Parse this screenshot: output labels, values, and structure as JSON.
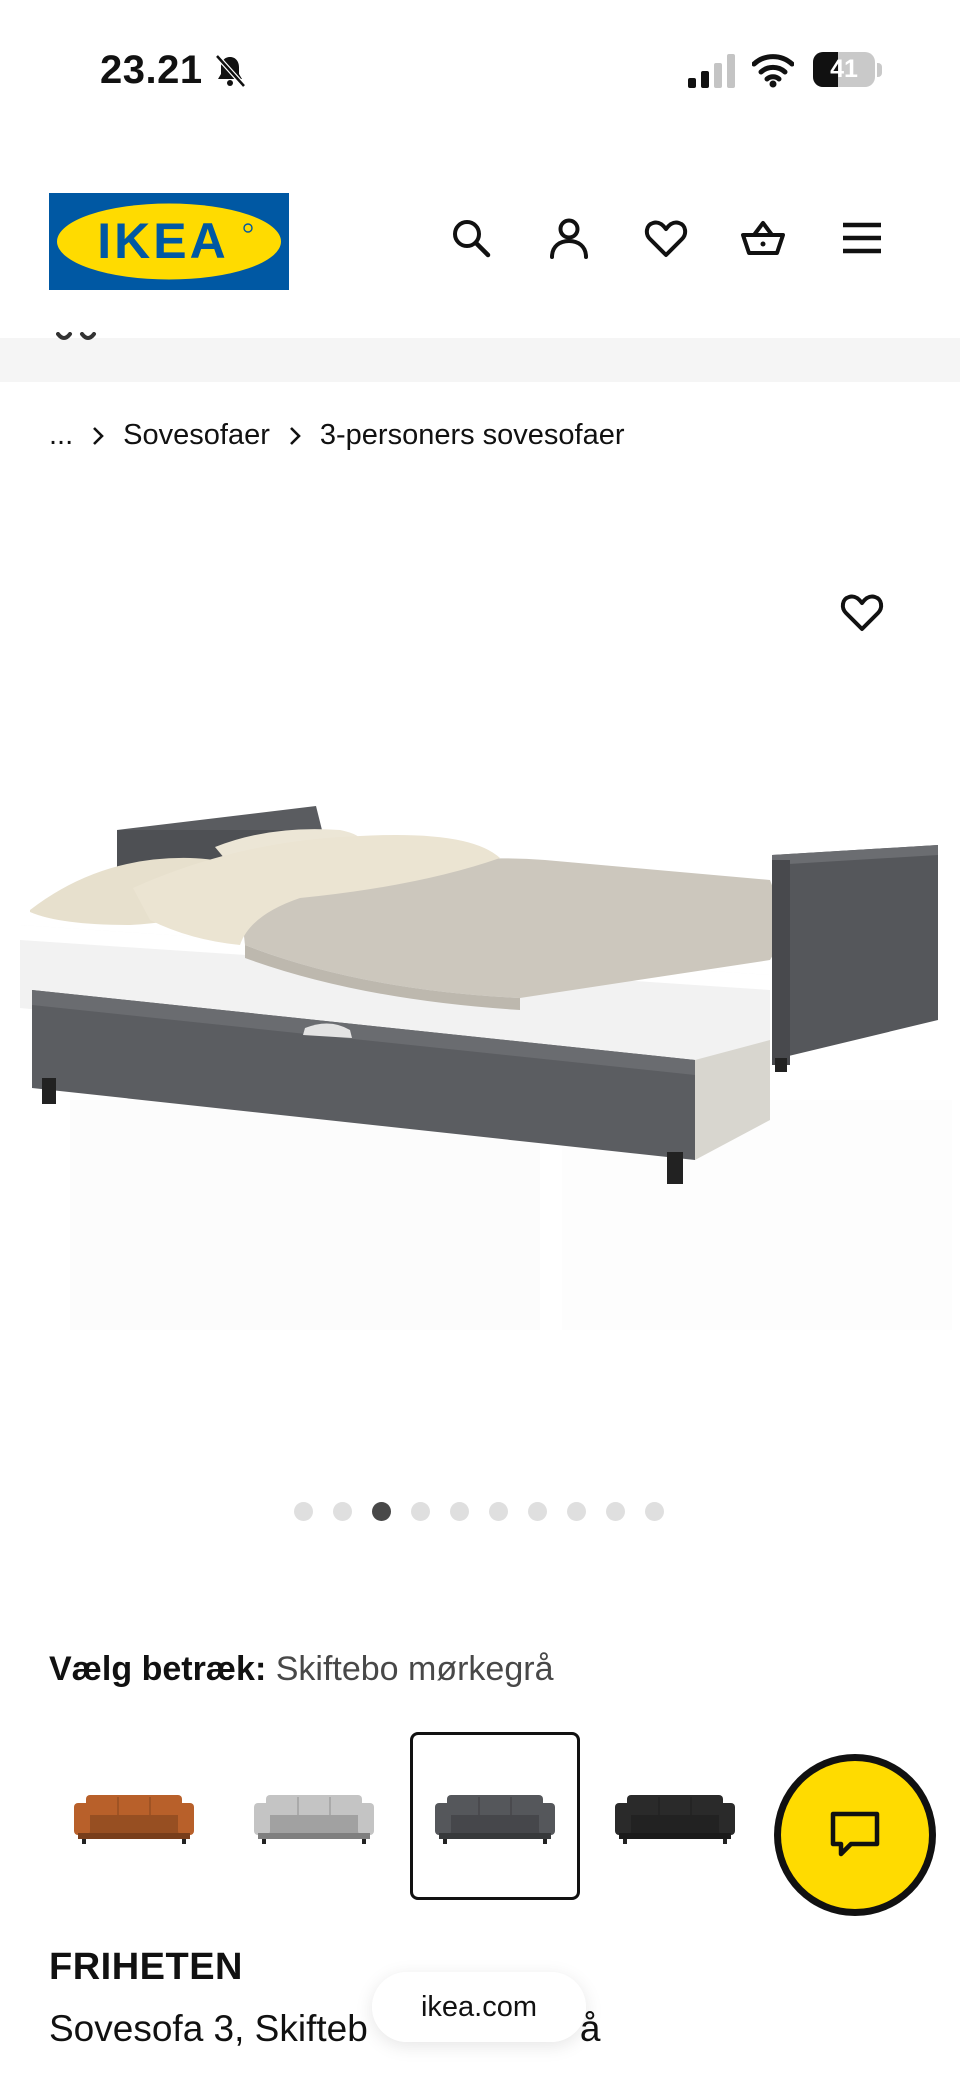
{
  "status_bar": {
    "time": "23.21",
    "battery_level": "41",
    "battery_fraction": 0.41,
    "icons": [
      "bell-slash-icon",
      "signal-icon",
      "wifi-icon",
      "battery-icon"
    ]
  },
  "header": {
    "logo_text": "IKEA",
    "brand_colors": {
      "blue": "#0058a3",
      "yellow": "#ffdb00"
    },
    "icons": [
      "search-icon",
      "profile-icon",
      "heart-icon",
      "basket-icon",
      "menu-icon"
    ]
  },
  "breadcrumb": {
    "items": [
      "...",
      "Sovesofaer",
      "3-personers sovesofaer"
    ]
  },
  "gallery": {
    "dot_count": 10,
    "active_index": 2
  },
  "cover": {
    "label": "Vælg betræk:",
    "value": "Skiftebo mørkegrå",
    "swatch_colors": [
      "#b8602a",
      "#c4c4c4",
      "#55575b",
      "#2a2a2a"
    ],
    "selected_index": 2
  },
  "product": {
    "name": "FRIHETEN",
    "description": "Sovesofa 3, Skifteb",
    "description_tail": "å"
  },
  "browser": {
    "url": "ikea.com"
  }
}
